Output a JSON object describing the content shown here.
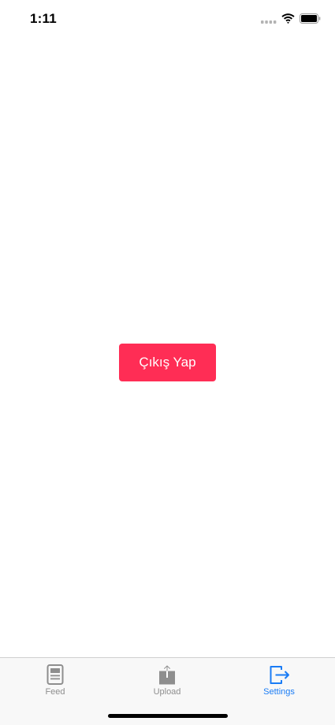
{
  "status_bar": {
    "time": "1:11",
    "icons": [
      "signal-icon",
      "wifi-icon",
      "battery-icon"
    ]
  },
  "main": {
    "logout_label": "Çıkış Yap",
    "accent_color": "#ff2d55"
  },
  "tab_bar": {
    "active_color": "#1a7cf5",
    "inactive_color": "#8e8e8e",
    "items": [
      {
        "label": "Feed",
        "icon": "feed-icon",
        "active": false
      },
      {
        "label": "Upload",
        "icon": "upload-icon",
        "active": false
      },
      {
        "label": "Settings",
        "icon": "logout-icon",
        "active": true
      }
    ]
  }
}
